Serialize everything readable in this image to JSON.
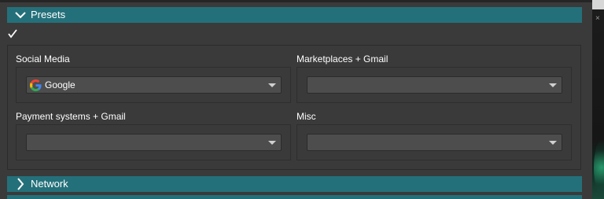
{
  "sections": {
    "presets": {
      "title": "Presets",
      "expanded": true
    },
    "network": {
      "title": "Network",
      "expanded": false
    }
  },
  "enabled_checkbox": {
    "checked": true
  },
  "groups": [
    {
      "label": "Social Media",
      "selected": "Google",
      "icon": "google-icon"
    },
    {
      "label": "Marketplaces + Gmail",
      "selected": ""
    },
    {
      "label": "Payment systems + Gmail",
      "selected": ""
    },
    {
      "label": "Misc",
      "selected": ""
    }
  ],
  "colors": {
    "section_header": "#24707a",
    "background": "#3a3a3a",
    "combo_bg": "#4d4d4d"
  }
}
